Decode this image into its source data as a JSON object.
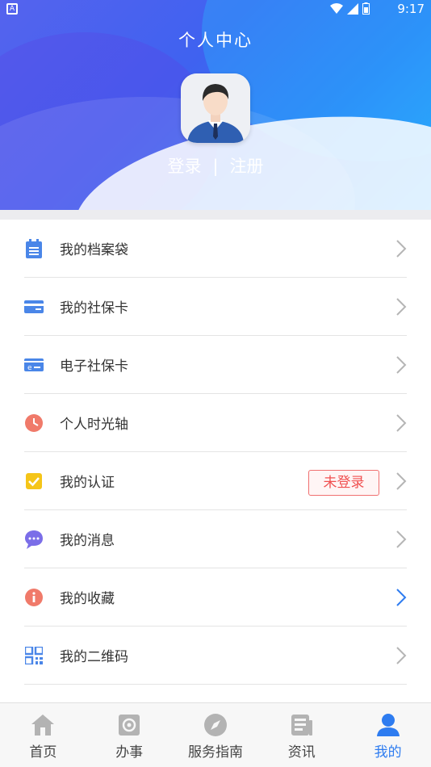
{
  "status_bar": {
    "time": "9:17"
  },
  "header": {
    "title": "个人中心",
    "login_label": "登录",
    "separator": "|",
    "register_label": "注册"
  },
  "menu": [
    {
      "label": "我的档案袋",
      "icon": "clipboard-icon",
      "color": "#4a86e8"
    },
    {
      "label": "我的社保卡",
      "icon": "card-icon",
      "color": "#4a86e8"
    },
    {
      "label": "电子社保卡",
      "icon": "ecard-icon",
      "color": "#4a86e8"
    },
    {
      "label": "个人时光轴",
      "icon": "clock-icon",
      "color": "#f07a6a"
    },
    {
      "label": "我的认证",
      "icon": "checkbox-icon",
      "color": "#f5c518",
      "badge": "未登录"
    },
    {
      "label": "我的消息",
      "icon": "chat-icon",
      "color": "#7b6ee8"
    },
    {
      "label": "我的收藏",
      "icon": "info-icon",
      "color": "#f07a6a"
    },
    {
      "label": "我的二维码",
      "icon": "qrcode-icon",
      "color": "#4a86e8"
    }
  ],
  "tabbar": [
    {
      "label": "首页",
      "icon": "home-icon"
    },
    {
      "label": "办事",
      "icon": "service-icon"
    },
    {
      "label": "服务指南",
      "icon": "compass-icon"
    },
    {
      "label": "资讯",
      "icon": "news-icon"
    },
    {
      "label": "我的",
      "icon": "user-icon",
      "active": true
    }
  ],
  "colors": {
    "accent": "#2e7cf0",
    "badge": "#f05050"
  }
}
